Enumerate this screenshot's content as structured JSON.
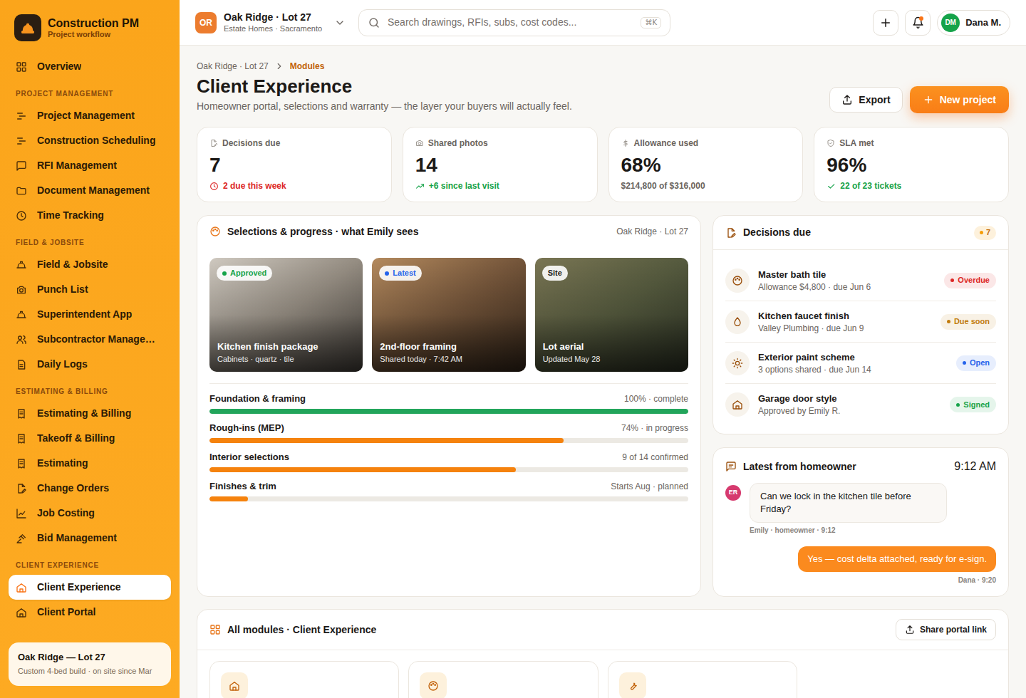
{
  "app": {
    "name": "Construction PM",
    "tagline": "Project workflow"
  },
  "sidebar": {
    "items": [
      {
        "label": "Overview",
        "selected": false
      }
    ],
    "sections": [
      {
        "title": "PROJECT MANAGEMENT",
        "items": [
          {
            "label": "Project Management",
            "selected": false
          },
          {
            "label": "Construction Scheduling",
            "selected": false
          },
          {
            "label": "RFI Management",
            "selected": false
          },
          {
            "label": "Document Management",
            "selected": false
          },
          {
            "label": "Time Tracking",
            "selected": false
          }
        ]
      },
      {
        "title": "FIELD & JOBSITE",
        "items": [
          {
            "label": "Field & Jobsite",
            "selected": false
          },
          {
            "label": "Punch List",
            "selected": false
          },
          {
            "label": "Superintendent App",
            "selected": false
          },
          {
            "label": "Subcontractor Manage…",
            "selected": false
          },
          {
            "label": "Daily Logs",
            "selected": false
          }
        ]
      },
      {
        "title": "ESTIMATING & BILLING",
        "items": [
          {
            "label": "Estimating & Billing",
            "selected": false
          },
          {
            "label": "Takeoff & Billing",
            "selected": false
          },
          {
            "label": "Estimating",
            "selected": false
          },
          {
            "label": "Change Orders",
            "selected": false
          },
          {
            "label": "Job Costing",
            "selected": false
          },
          {
            "label": "Bid Management",
            "selected": false
          }
        ]
      },
      {
        "title": "CLIENT EXPERIENCE",
        "items": [
          {
            "label": "Client Experience",
            "selected": true
          },
          {
            "label": "Client Portal",
            "selected": false
          }
        ]
      }
    ],
    "project_card": {
      "title": "Oak Ridge — Lot 27",
      "subtitle": "Custom 4-bed build · on site since Mar"
    }
  },
  "topbar": {
    "project": {
      "badge": "OR",
      "name": "Oak Ridge · Lot 27",
      "client": "Estate Homes · Sacramento"
    },
    "search": {
      "placeholder": "Search drawings, RFIs, subs, cost codes...",
      "shortcut": "⌘K"
    },
    "notifications": {
      "unread": true
    },
    "user": {
      "initials": "DM",
      "name": "Dana M."
    }
  },
  "breadcrumb": [
    "Oak Ridge · Lot 27",
    "Modules"
  ],
  "page": {
    "title": "Client Experience",
    "subtitle": "Homeowner portal, selections and warranty — the layer your buyers will actually feel."
  },
  "actions": [
    "Export",
    "New project"
  ],
  "stats": [
    {
      "label": "Decisions due",
      "value": "7",
      "note": "2 due this week",
      "color": "#dc2626"
    },
    {
      "label": "Shared photos",
      "value": "14",
      "note": "+6 since last visit",
      "color": "#16a34a"
    },
    {
      "label": "Allowance used",
      "value": "68%",
      "note": "$214,800 of $316,000",
      "color": "#6b6560"
    },
    {
      "label": "SLA met",
      "value": "96%",
      "note": "22 of 23 tickets",
      "color": "#16a34a"
    }
  ],
  "selections": {
    "title": "Selections & progress · what Emily sees",
    "project": "Oak Ridge · Lot 27",
    "photos": [
      {
        "badge": "Approved",
        "dot": true,
        "color": "#16a34a",
        "title": "Kitchen finish package",
        "subtitle": "Cabinets · quartz · tile"
      },
      {
        "badge": "Latest",
        "dot": true,
        "color": "#2563eb",
        "title": "2nd-floor framing",
        "subtitle": "Shared today · 7:42 AM"
      },
      {
        "badge": "Site",
        "dot": false,
        "color": "#1c1917",
        "title": "Lot aerial",
        "subtitle": "Updated May 28"
      }
    ],
    "progress": [
      {
        "label": "Foundation & framing",
        "reading": "100% · complete",
        "level": 1,
        "color": "#22a55b"
      },
      {
        "label": "Rough-ins (MEP)",
        "reading": "74% · in progress",
        "level": 0.74,
        "color": "#f5820d"
      },
      {
        "label": "Interior selections",
        "reading": "9 of 14 confirmed",
        "level": 0.64,
        "color": "#f5820d"
      },
      {
        "label": "Finishes & trim",
        "reading": "Starts Aug · planned",
        "level": 0.08,
        "color": "#f5820d"
      }
    ]
  },
  "decisions": {
    "title": "Decisions due",
    "count": "7",
    "items": [
      {
        "title": "Master bath tile",
        "detail": "Allowance $4,800 · due Jun 6",
        "status": "Overdue",
        "color": "#dc2626"
      },
      {
        "title": "Kitchen faucet finish",
        "detail": "Valley Plumbing · due Jun 9",
        "status": "Due soon",
        "color": "#c27c0e"
      },
      {
        "title": "Exterior paint scheme",
        "detail": "3 options shared · due Jun 14",
        "status": "Open",
        "color": "#2563eb"
      },
      {
        "title": "Garage door style",
        "detail": "Approved by Emily R.",
        "status": "Signed",
        "color": "#16a34a"
      }
    ]
  },
  "messages": {
    "title": "Latest from homeowner",
    "time": "9:12 AM",
    "items": [
      {
        "kind": "incoming",
        "avatar": "ER",
        "text": "Can we lock in the kitchen tile before Friday?",
        "meta": "Emily · homeowner · 9:12"
      },
      {
        "kind": "outgoing",
        "text": "Yes — cost delta attached, ready for e-sign.",
        "meta": "Dana · 9:20"
      }
    ]
  },
  "modules": {
    "title": "All modules · Client Experience",
    "button": "Share portal link"
  }
}
